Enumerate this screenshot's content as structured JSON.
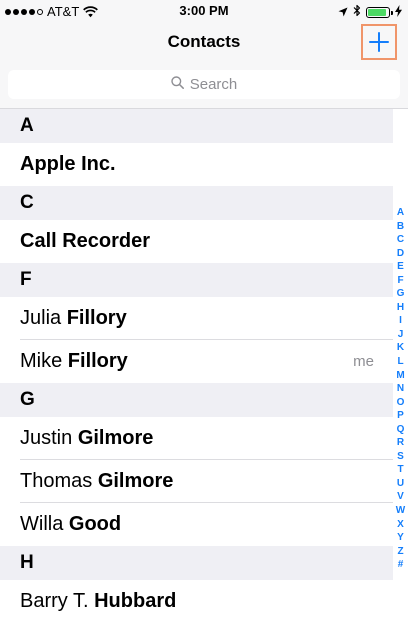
{
  "status_bar": {
    "carrier": "AT&T",
    "time": "3:00 PM",
    "signal_bars": 4,
    "signal_total": 5,
    "battery_level": 0.9,
    "battery_color": "#4cd964"
  },
  "nav": {
    "title": "Contacts",
    "add_icon": "plus-icon",
    "accent_color": "#147efb",
    "highlight_color": "#f0956a"
  },
  "search": {
    "placeholder": "Search",
    "icon": "search-icon"
  },
  "sections": [
    {
      "letter": "A",
      "contacts": [
        {
          "first": "",
          "last": "",
          "company": "Apple Inc.",
          "tag": ""
        }
      ]
    },
    {
      "letter": "C",
      "contacts": [
        {
          "first": "",
          "last": "",
          "company": "Call Recorder",
          "tag": ""
        }
      ]
    },
    {
      "letter": "F",
      "contacts": [
        {
          "first": "Julia",
          "last": "Fillory",
          "company": "",
          "tag": ""
        },
        {
          "first": "Mike",
          "last": "Fillory",
          "company": "",
          "tag": "me"
        }
      ]
    },
    {
      "letter": "G",
      "contacts": [
        {
          "first": "Justin",
          "last": "Gilmore",
          "company": "",
          "tag": ""
        },
        {
          "first": "Thomas",
          "last": "Gilmore",
          "company": "",
          "tag": ""
        },
        {
          "first": "Willa",
          "last": "Good",
          "company": "",
          "tag": ""
        }
      ]
    },
    {
      "letter": "H",
      "contacts": [
        {
          "first": "Barry T.",
          "last": "Hubbard",
          "company": "",
          "tag": ""
        }
      ]
    }
  ],
  "index_letters": [
    "A",
    "B",
    "C",
    "D",
    "E",
    "F",
    "G",
    "H",
    "I",
    "J",
    "K",
    "L",
    "M",
    "N",
    "O",
    "P",
    "Q",
    "R",
    "S",
    "T",
    "U",
    "V",
    "W",
    "X",
    "Y",
    "Z",
    "#"
  ]
}
